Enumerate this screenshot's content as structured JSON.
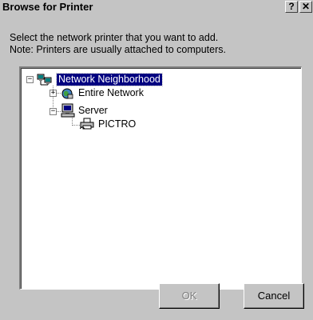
{
  "window": {
    "title": "Browse for Printer",
    "help_label": "?",
    "close_label": "✕"
  },
  "description": {
    "line1": "Select the network printer that you want to add.",
    "line2": "Note: Printers are usually attached to computers."
  },
  "tree": {
    "nodes": [
      {
        "label": "Network Neighborhood",
        "expander": "−",
        "icon": "network-neighborhood-icon",
        "selected": true
      },
      {
        "label": "Entire Network",
        "expander": "+",
        "icon": "entire-network-icon",
        "selected": false
      },
      {
        "label": "Server",
        "expander": "−",
        "icon": "server-computer-icon",
        "selected": false
      },
      {
        "label": "PICTRO",
        "expander": "",
        "icon": "printer-icon",
        "selected": false
      }
    ]
  },
  "buttons": {
    "ok_label": "OK",
    "ok_enabled": false,
    "cancel_label": "Cancel"
  }
}
